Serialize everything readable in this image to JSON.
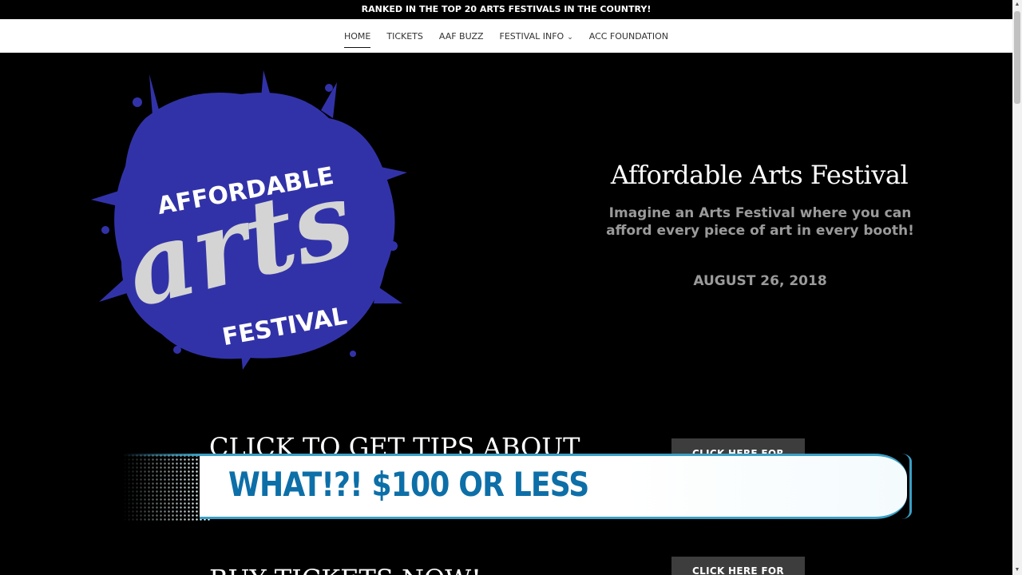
{
  "announcement": "RANKED IN THE TOP 20 ARTS FESTIVALS IN THE COUNTRY!",
  "nav": {
    "items": [
      {
        "label": "HOME"
      },
      {
        "label": "TICKETS"
      },
      {
        "label": "AAF BUZZ"
      },
      {
        "label": "FESTIVAL INFO"
      },
      {
        "label": "ACC FOUNDATION"
      }
    ]
  },
  "logo": {
    "line1": "AFFORDABLE",
    "line2": "arts",
    "line3": "FESTIVAL",
    "splash_color": "#3232a8",
    "text_color": "#ffffff",
    "script_color": "#d4d4d4"
  },
  "hero": {
    "title": "Affordable Arts Festival",
    "subtitle_line1": "Imagine an Arts Festival where you can",
    "subtitle_line2": "afford every piece of art in every booth!",
    "date": "AUGUST 26, 2018"
  },
  "sections": [
    {
      "heading": "CLICK TO GET TIPS ABOUT",
      "button": "CLICK HERE FOR"
    },
    {
      "heading": "BUY TICKETS NOW!",
      "button": "CLICK HERE FOR"
    }
  ],
  "lower_third": {
    "text": "WHAT!?! $100 OR LESS",
    "accent_color": "#3a9fc4",
    "text_color": "#0d6fa8"
  },
  "icons": {
    "festival_info_chevron": "chevron-down-icon",
    "scroll_up": "scroll-up-icon",
    "scroll_down": "scroll-down-icon"
  }
}
